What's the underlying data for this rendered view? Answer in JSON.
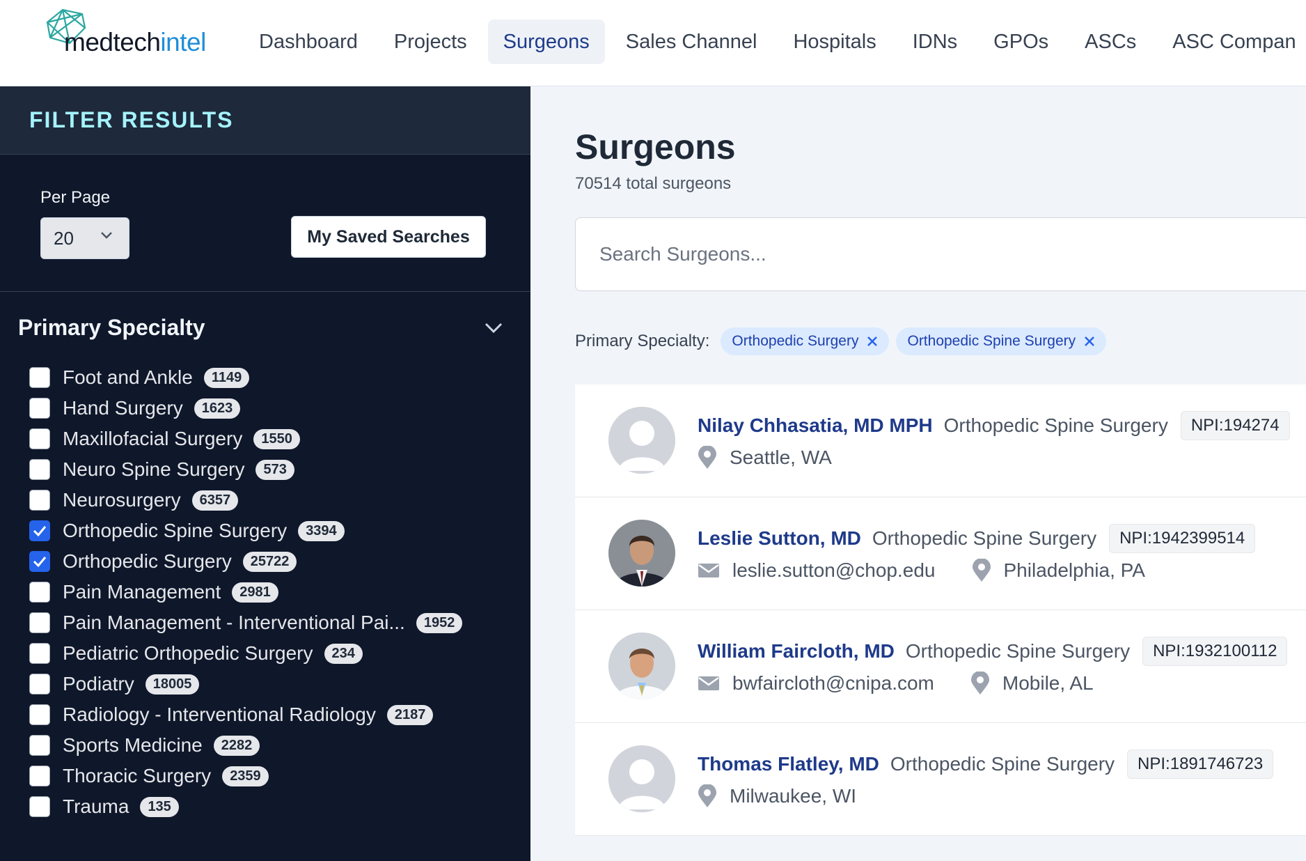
{
  "nav": {
    "logo": {
      "prefix": "medtech",
      "accent": "intel"
    },
    "items": [
      "Dashboard",
      "Projects",
      "Surgeons",
      "Sales Channel",
      "Hospitals",
      "IDNs",
      "GPOs",
      "ASCs",
      "ASC Compan"
    ],
    "active": "Surgeons"
  },
  "sidebar": {
    "title": "FILTER RESULTS",
    "per_page_label": "Per Page",
    "per_page_value": "20",
    "saved_searches_label": "My Saved Searches",
    "specialty_title": "Primary Specialty",
    "specialties": [
      {
        "label": "Foot and Ankle",
        "count": "1149",
        "checked": false
      },
      {
        "label": "Hand Surgery",
        "count": "1623",
        "checked": false
      },
      {
        "label": "Maxillofacial Surgery",
        "count": "1550",
        "checked": false
      },
      {
        "label": "Neuro Spine Surgery",
        "count": "573",
        "checked": false
      },
      {
        "label": "Neurosurgery",
        "count": "6357",
        "checked": false
      },
      {
        "label": "Orthopedic Spine Surgery",
        "count": "3394",
        "checked": true
      },
      {
        "label": "Orthopedic Surgery",
        "count": "25722",
        "checked": true
      },
      {
        "label": "Pain Management",
        "count": "2981",
        "checked": false
      },
      {
        "label": "Pain Management - Interventional Pai...",
        "count": "1952",
        "checked": false
      },
      {
        "label": "Pediatric Orthopedic Surgery",
        "count": "234",
        "checked": false
      },
      {
        "label": "Podiatry",
        "count": "18005",
        "checked": false
      },
      {
        "label": "Radiology - Interventional Radiology",
        "count": "2187",
        "checked": false
      },
      {
        "label": "Sports Medicine",
        "count": "2282",
        "checked": false
      },
      {
        "label": "Thoracic Surgery",
        "count": "2359",
        "checked": false
      },
      {
        "label": "Trauma",
        "count": "135",
        "checked": false
      }
    ]
  },
  "main": {
    "title": "Surgeons",
    "total": "70514 total surgeons",
    "search_placeholder": "Search Surgeons...",
    "active_filters_label": "Primary Specialty:",
    "active_filters": [
      "Orthopedic Surgery",
      "Orthopedic Spine Surgery"
    ],
    "results": [
      {
        "name": "Nilay Chhasatia, MD MPH",
        "specialty": "Orthopedic Spine Surgery",
        "npi": "NPI:194274",
        "email": "",
        "location": "Seattle, WA",
        "photo": "placeholder"
      },
      {
        "name": "Leslie Sutton, MD",
        "specialty": "Orthopedic Spine Surgery",
        "npi": "NPI:1942399514",
        "email": "leslie.sutton@chop.edu",
        "location": "Philadelphia, PA",
        "photo": "photo-dark-suit"
      },
      {
        "name": "William Faircloth, MD",
        "specialty": "Orthopedic Spine Surgery",
        "npi": "NPI:1932100112",
        "email": "bwfaircloth@cnipa.com",
        "location": "Mobile, AL",
        "photo": "photo-white-coat"
      },
      {
        "name": "Thomas Flatley, MD",
        "specialty": "Orthopedic Spine Surgery",
        "npi": "NPI:1891746723",
        "email": "",
        "location": "Milwaukee, WI",
        "photo": "placeholder"
      }
    ]
  },
  "colors": {
    "sidebar_bg": "#0f172a",
    "filter_header_bg": "#1e293b",
    "accent_blue": "#2563eb",
    "name_blue": "#1e3a8a",
    "filter_title": "#a5f3fc"
  }
}
